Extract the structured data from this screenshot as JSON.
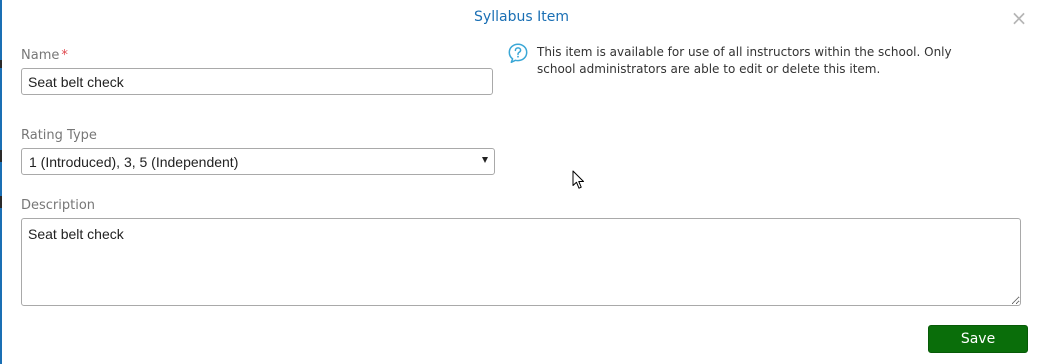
{
  "modal": {
    "title": "Syllabus Item",
    "close_glyph": "×",
    "save_label": "Save"
  },
  "name_field": {
    "label": "Name",
    "required_mark": "*",
    "value": "Seat belt check"
  },
  "info": {
    "icon": "question-circle-icon",
    "text": "This item is available for use of all instructors within the school. Only school administrators are able to edit or delete this item."
  },
  "rating_field": {
    "label": "Rating Type",
    "selected": "1 (Introduced), 3, 5 (Independent)"
  },
  "description_field": {
    "label": "Description",
    "value": "Seat belt check"
  },
  "colors": {
    "accent": "#1a6fb4",
    "save_button": "#0a6e0a",
    "required": "#e0474c",
    "info_icon": "#3aa7d6"
  }
}
